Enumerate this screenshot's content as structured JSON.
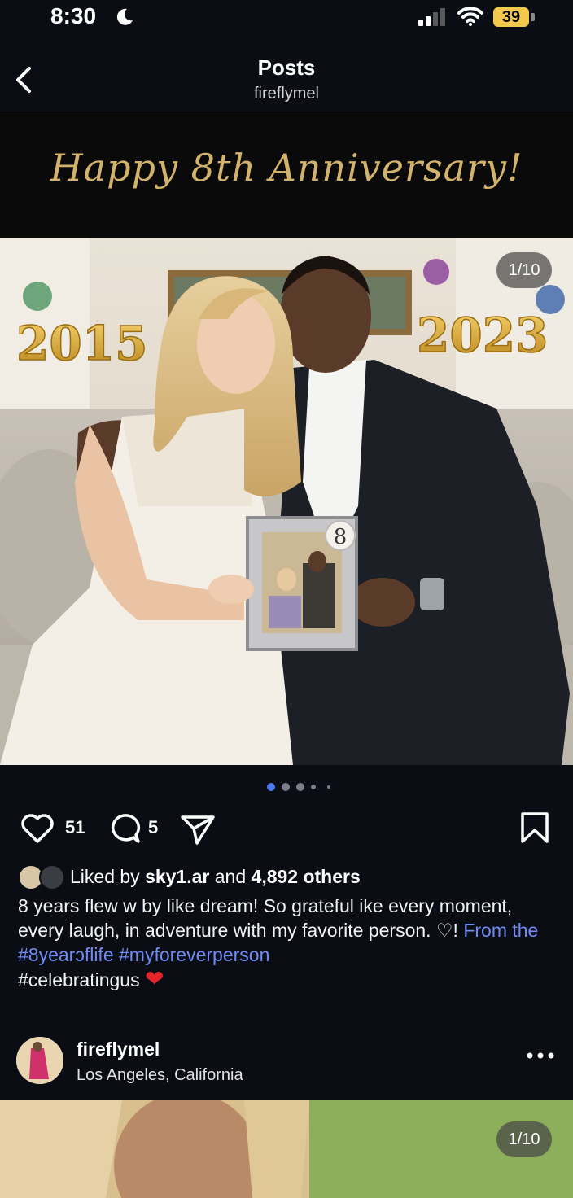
{
  "status_bar": {
    "time": "8:30",
    "battery": "39"
  },
  "header": {
    "title": "Posts",
    "username": "fireflymel"
  },
  "post": {
    "banner_text": "Happy 8th Anniversary!",
    "image_counter": "1/10",
    "balloon_left": "2015",
    "balloon_right": "2023",
    "frame_number": "8",
    "like_count": "51",
    "comment_count": "5",
    "likes": {
      "prefix": "Liked by",
      "user": "sky1.ar",
      "connector": "and",
      "others": "4,892 others"
    },
    "caption": {
      "text": "8 years flew w by like dream! So grateful ike every moment, every laugh, in adventure with my favorite person. ♡! ",
      "hashtags": "From the #8yearɔflife #myforeverperson",
      "tail": "#celebratingus",
      "emoji": "❤"
    }
  },
  "next_post": {
    "username": "fireflymel",
    "location": "Los Angeles, California",
    "image_counter": "1/10"
  },
  "colors": {
    "background": "#0b0d14",
    "banner_gold": "#d3b36b",
    "hashtag_blue": "#6f8cf5",
    "active_dot": "#4a78f0",
    "battery_yellow": "#f2c94c"
  },
  "icons": [
    "moon-icon",
    "signal-icon",
    "wifi-icon",
    "back-icon",
    "heart-icon",
    "comment-icon",
    "share-icon",
    "bookmark-icon",
    "more-icon"
  ]
}
